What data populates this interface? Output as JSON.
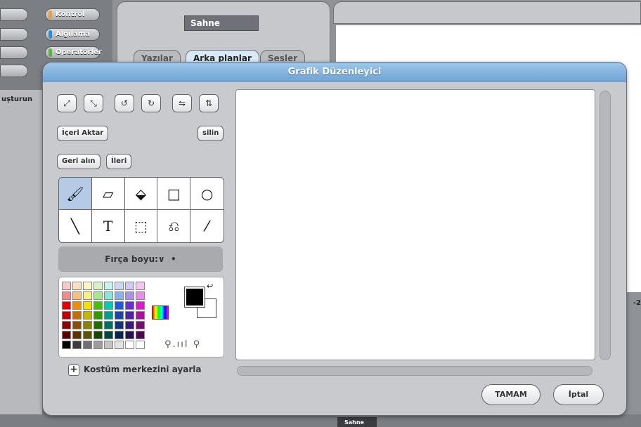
{
  "background": {
    "categories": [
      {
        "label": "Kontrol",
        "color": "#e6a13a"
      },
      {
        "label": "Algılama",
        "color": "#2d8fd8"
      },
      {
        "label": "Operatörler",
        "color": "#5cb23d"
      }
    ],
    "left_strip_label": "uşturun",
    "stage_title": "Sahne",
    "tabs": [
      "Yazılar",
      "Arka planlar",
      "Sesler"
    ],
    "right_number": "-2",
    "bottom_tab": "Sahne"
  },
  "dialog": {
    "title": "Grafik Düzenleyici",
    "transform_buttons": [
      {
        "name": "grow-icon",
        "glyph": "⤢"
      },
      {
        "name": "shrink-icon",
        "glyph": "⤡"
      },
      {
        "name": "rotate-ccw-icon",
        "glyph": "↺"
      },
      {
        "name": "rotate-cw-icon",
        "glyph": "↻"
      },
      {
        "name": "flip-horizontal-icon",
        "glyph": "⇋"
      },
      {
        "name": "flip-vertical-icon",
        "glyph": "⇅"
      }
    ],
    "import_label": "İçeri Aktar",
    "clear_label": "silin",
    "undo_label": "Geri alın",
    "redo_label": "İleri",
    "tools": [
      {
        "name": "paintbrush-icon",
        "glyph": "🖌"
      },
      {
        "name": "eraser-icon",
        "glyph": "▱"
      },
      {
        "name": "fill-bucket-icon",
        "glyph": "⬙"
      },
      {
        "name": "rectangle-icon",
        "glyph": "□"
      },
      {
        "name": "ellipse-icon",
        "glyph": "○"
      },
      {
        "name": "line-icon",
        "glyph": "╲"
      },
      {
        "name": "text-icon",
        "glyph": "T"
      },
      {
        "name": "select-icon",
        "glyph": "⬚"
      },
      {
        "name": "stamp-icon",
        "glyph": "⎌"
      },
      {
        "name": "eyedropper-icon",
        "glyph": "⁄"
      }
    ],
    "brush_size_label": "Fırça boyu:",
    "brush_size_arrow": "∨",
    "brush_dot": "•",
    "swatch_colors": [
      "#f9c9c9",
      "#fbe0c0",
      "#fbf8c4",
      "#d3f3c6",
      "#c8f4ec",
      "#c8d8f6",
      "#d5c8f4",
      "#f1c7f0",
      "#f48b8b",
      "#f8c07f",
      "#f6ef8a",
      "#a9e58f",
      "#8be6d8",
      "#8caeeb",
      "#aa92e9",
      "#e58ee2",
      "#e80000",
      "#f28a00",
      "#f3e000",
      "#41c300",
      "#00ccb4",
      "#1f5bd9",
      "#6a2ed6",
      "#d61ccc",
      "#bf0000",
      "#c76d00",
      "#c6b600",
      "#2f9a00",
      "#009e8b",
      "#1a47a9",
      "#5221a8",
      "#a8129f",
      "#8a0000",
      "#8d4d00",
      "#8d8200",
      "#1f6d00",
      "#006f62",
      "#123479",
      "#3b1879",
      "#780c72",
      "#5a0000",
      "#5d3300",
      "#5c5500",
      "#144700",
      "#004740",
      "#0c224f",
      "#26104f",
      "#4e074a",
      "#000000",
      "#3c3c3c",
      "#707070",
      "#9c9c9c",
      "#c4c4c4",
      "#e2e2e2",
      "#ffffff",
      "#ffffff"
    ],
    "foreground_color": "#000000",
    "background_color": "#ffffff",
    "zoom_text": "⚲.ııl ⚲",
    "set_center_label": "Kostüm merkezini ayarla",
    "ok_label": "TAMAM",
    "cancel_label": "İptal"
  }
}
